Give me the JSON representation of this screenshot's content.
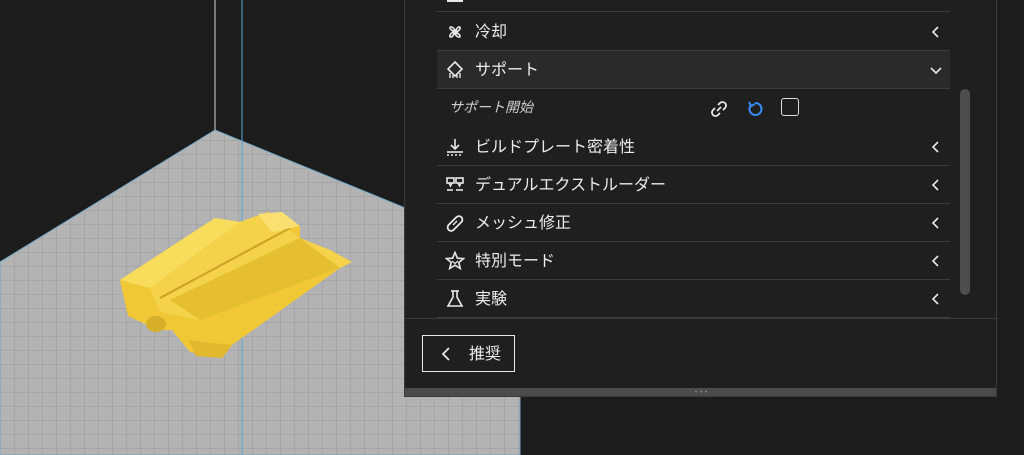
{
  "panel": {
    "rows": [
      {
        "label": "冷却",
        "icon": "fan-icon"
      },
      {
        "label": "サポート",
        "icon": "support-icon",
        "expanded": true
      },
      {
        "label": "ビルドプレート密着性",
        "icon": "build-plate-adhesion-icon"
      },
      {
        "label": "デュアルエクストルーダー",
        "icon": "dual-extruder-icon"
      },
      {
        "label": "メッシュ修正",
        "icon": "bandage-icon"
      },
      {
        "label": "特別モード",
        "icon": "star-icon"
      },
      {
        "label": "実験",
        "icon": "flask-icon"
      }
    ],
    "support_setting": {
      "label": "サポート開始",
      "checked": false
    },
    "recommend_button": "推奨"
  },
  "colors": {
    "background": "#1c1c1c",
    "panel": "#1f1f1f",
    "model": "#f3d34a",
    "build_plate": "#b0b0b0",
    "accent_blue": "#3b8bff"
  }
}
